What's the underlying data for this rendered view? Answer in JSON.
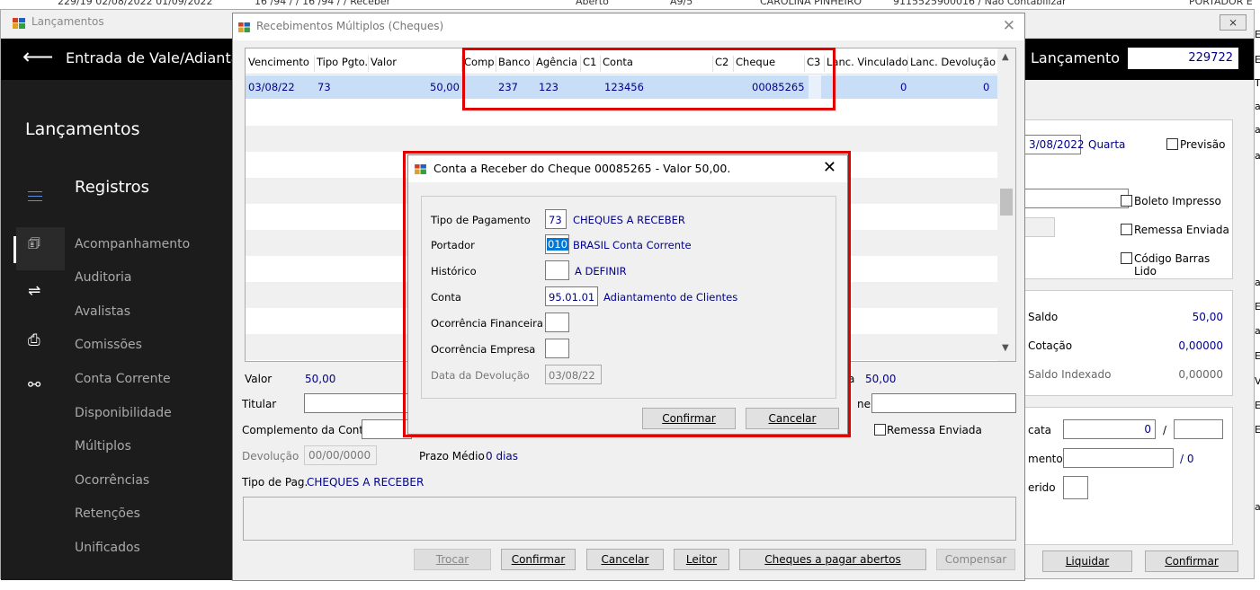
{
  "background": {
    "top_strip_fragments": [
      "229/19  02/08/2022  01/09/2022",
      "16 /94 / /  16 /94 / /  Receber",
      "Aberto",
      "A9/5",
      "CAROLINA PINHEIRO",
      "9115525900016 /  Não Contabilizar",
      "PORTADOR E"
    ]
  },
  "main_window": {
    "title": "Lançamentos",
    "close_label": "⨯",
    "header_title": "Entrada de Vale/Adianta",
    "lancamento_label": "Lançamento",
    "lancamento_value": "229722"
  },
  "sidebar": {
    "section_title": "Lançamentos",
    "group_title": "Registros",
    "items": [
      {
        "label": "Acompanhamento"
      },
      {
        "label": "Auditoria"
      },
      {
        "label": "Avalistas"
      },
      {
        "label": "Comissões"
      },
      {
        "label": "Conta Corrente"
      },
      {
        "label": "Disponibilidade"
      },
      {
        "label": "Múltiplos"
      },
      {
        "label": "Ocorrências"
      },
      {
        "label": "Retenções"
      },
      {
        "label": "Unificados"
      }
    ]
  },
  "right_panel": {
    "date_value": "3/08/2022",
    "weekday": "Quarta",
    "previsao_label": "Previsão",
    "boleto_label": "Boleto Impresso",
    "remessa_label": "Remessa Enviada",
    "codigo_label": "Código Barras Lido",
    "saldo_label": "Saldo",
    "saldo_value": "50,00",
    "cotacao_label": "Cotação",
    "cotacao_value": "0,00000",
    "saldo_idx_label": "Saldo Indexado",
    "saldo_idx_value": "0,00000",
    "cata_label": "cata",
    "cata_value": "0",
    "slash": "/",
    "mento_label": "mento",
    "mento_suffix": "/  0",
    "erido_label": "erido",
    "liquidar_label": "Liquidar",
    "confirmar_label": "Confirmar"
  },
  "edge_letters": [
    "E",
    "E",
    "TA",
    "a",
    "a",
    "a",
    "a",
    "ES",
    "a",
    "E",
    "Vo",
    "E",
    "E",
    "a"
  ],
  "recebimentos": {
    "title": "Recebimentos Múltiplos (Cheques)",
    "close": "✕",
    "columns": [
      "Vencimento",
      "Tipo Pgto.",
      "Valor",
      "Comp.",
      "Banco",
      "Agência",
      "C1",
      "Conta",
      "C2",
      "Cheque",
      "C3",
      "Lanc. Vinculado",
      "Lanc. Devolução"
    ],
    "rows": [
      {
        "vencimento": "03/08/22",
        "tipo": "73",
        "valor": "50,00",
        "comp": "",
        "banco": "237",
        "agencia": "123",
        "c1": "",
        "conta": "123456",
        "c2": "",
        "cheque": "00085265",
        "c3": "",
        "vinculado": "0",
        "devolucao": "0"
      }
    ],
    "valor_label": "Valor",
    "valor_value": "50,00",
    "valor2_value": "50,00",
    "titular_label": "Titular",
    "ne_label": "ne",
    "complemento_label": "Complemento da Conta",
    "remessa_label": "Remessa Enviada",
    "devolucao_label": "Devolução",
    "devolucao_value": "00/00/0000",
    "prazo_label": "Prazo Médio",
    "prazo_value": "0 dias",
    "tipo_pag_label": "Tipo de Pag.",
    "tipo_pag_value": "CHEQUES A RECEBER",
    "buttons": {
      "trocar": "Trocar",
      "confirmar": "Confirmar",
      "cancelar": "Cancelar",
      "leitor": "Leitor",
      "cheques": "Cheques a pagar abertos",
      "compensar": "Compensar"
    }
  },
  "conta_receber": {
    "title": "Conta a Receber do Cheque 00085265 - Valor 50,00.",
    "close": "✕",
    "fields": {
      "tipo_pagamento": {
        "label": "Tipo de Pagamento",
        "value": "73",
        "desc": "CHEQUES A RECEBER"
      },
      "portador": {
        "label": "Portador",
        "value": "010",
        "desc": "BRASIL Conta Corrente"
      },
      "historico": {
        "label": "Histórico",
        "value": "",
        "desc": "A DEFINIR"
      },
      "conta": {
        "label": "Conta",
        "value": "95.01.01",
        "desc": "Adiantamento de Clientes"
      },
      "ocorrencia_fin": {
        "label": "Ocorrência Financeira",
        "value": ""
      },
      "ocorrencia_emp": {
        "label": "Ocorrência Empresa",
        "value": ""
      },
      "data_devolucao": {
        "label": "Data da Devolução",
        "value": "03/08/22"
      }
    },
    "confirmar_label": "Confirmar",
    "cancelar_label": "Cancelar"
  },
  "colors": {
    "accent_blue": "#00008b",
    "highlight_red": "#e00000",
    "selection": "#c8def7",
    "sidebar_bg": "#1c1c1c"
  }
}
